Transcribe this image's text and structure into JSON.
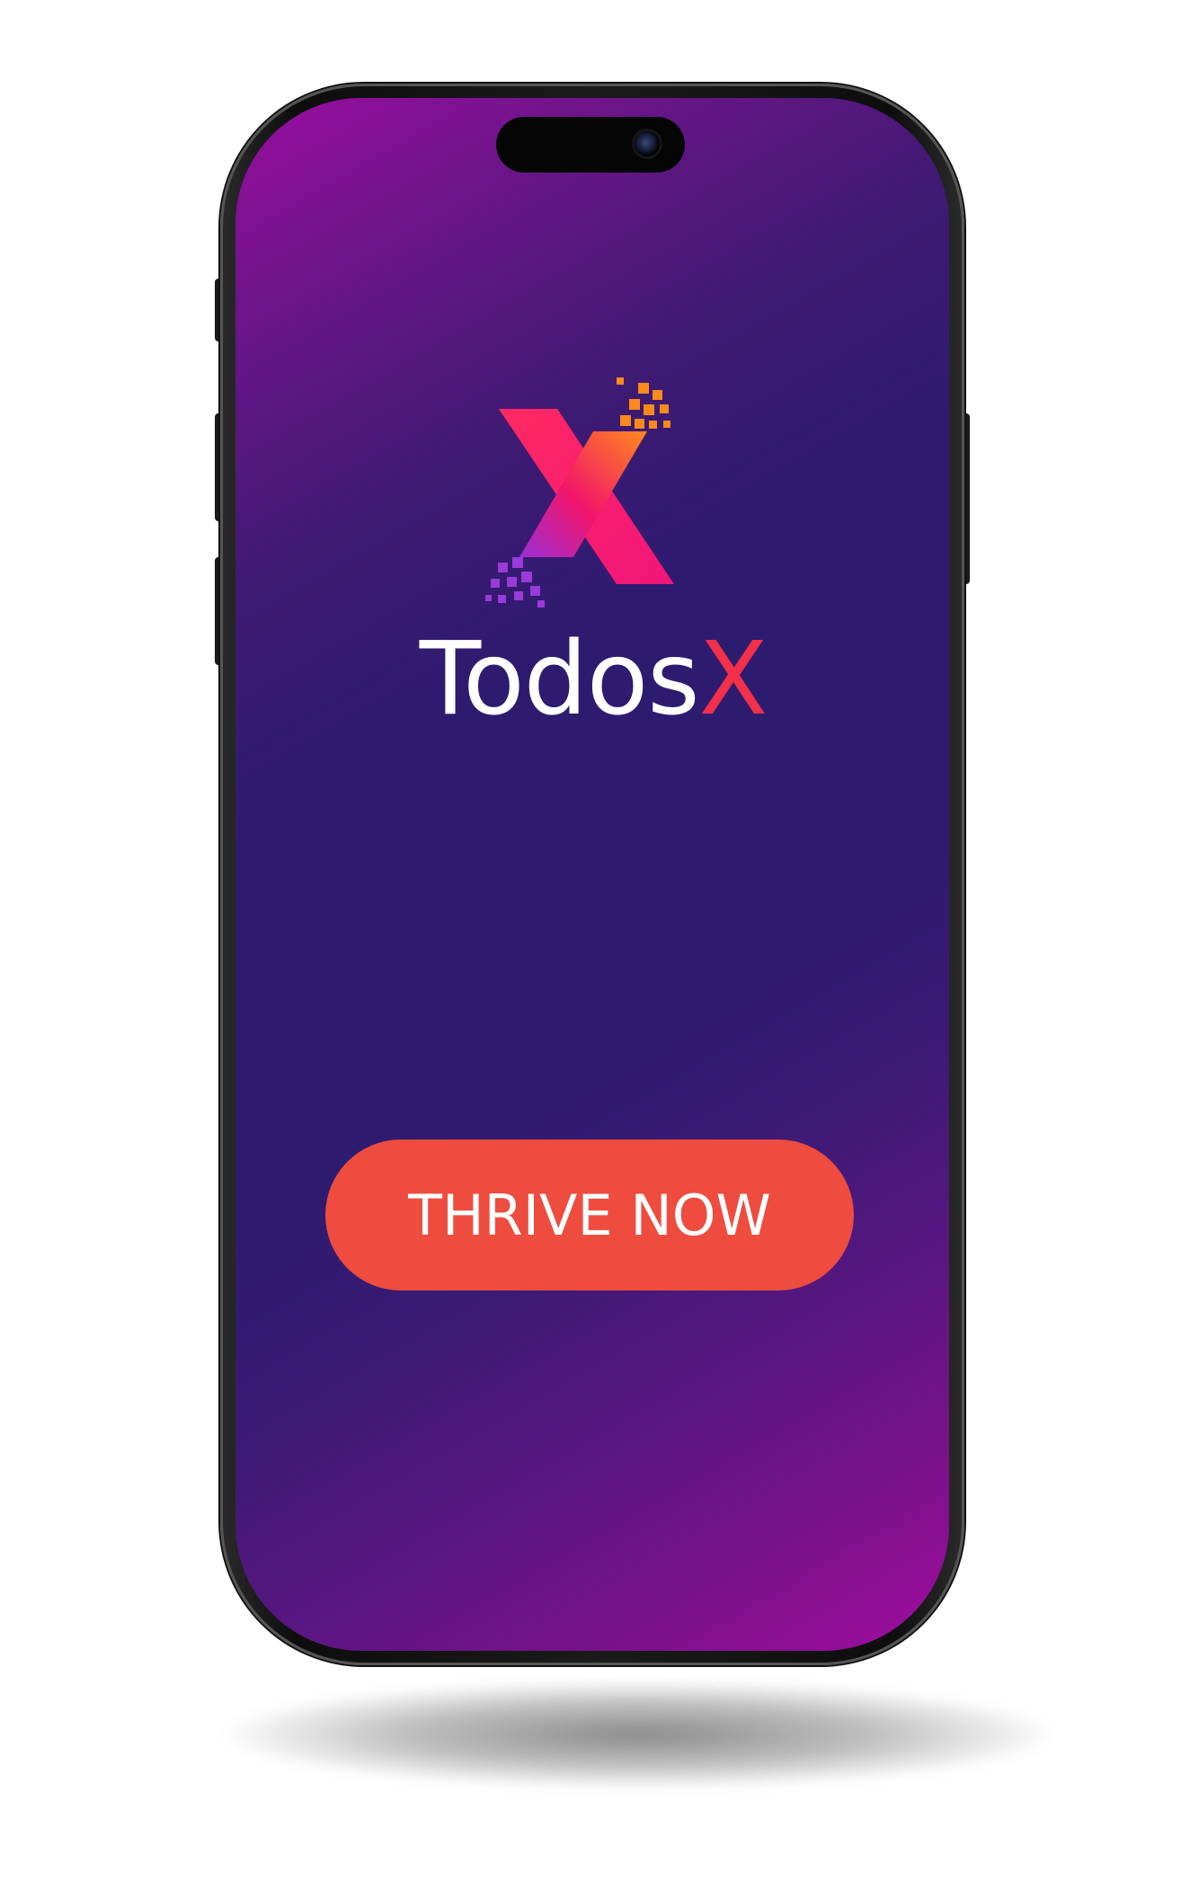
{
  "app": {
    "name_part1": "Todos",
    "name_part2": "X"
  },
  "cta": {
    "label": "THRIVE NOW"
  },
  "colors": {
    "background_dark": "#2d1b70",
    "background_corner": "#9b0ea0",
    "accent": "#f2304a",
    "button": "#ee4c3e",
    "text": "#ffffff"
  },
  "icons": {
    "logo": "x-logo-icon",
    "camera": "camera-icon"
  }
}
